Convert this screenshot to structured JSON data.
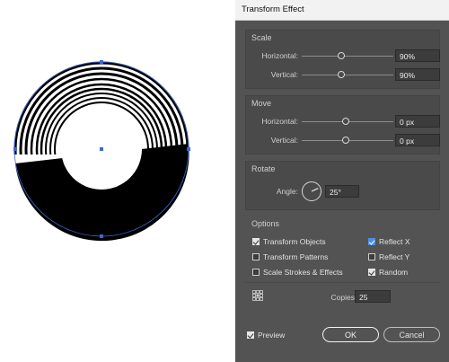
{
  "dialog": {
    "title": "Transform Effect",
    "scale": {
      "title": "Scale",
      "horizontal_label": "Horizontal:",
      "horizontal_value": "90%",
      "vertical_label": "Vertical:",
      "vertical_value": "90%"
    },
    "move": {
      "title": "Move",
      "horizontal_label": "Horizontal:",
      "horizontal_value": "0 px",
      "vertical_label": "Vertical:",
      "vertical_value": "0 px"
    },
    "rotate": {
      "title": "Rotate",
      "angle_label": "Angle:",
      "angle_value": "25°",
      "angle_degrees": 25
    },
    "options": {
      "title": "Options",
      "transform_objects": {
        "label": "Transform Objects",
        "checked": true
      },
      "transform_patterns": {
        "label": "Transform Patterns",
        "checked": false
      },
      "scale_strokes": {
        "label": "Scale Strokes & Effects",
        "checked": false
      },
      "reflect_x": {
        "label": "Reflect X",
        "checked": true
      },
      "reflect_y": {
        "label": "Reflect Y",
        "checked": false
      },
      "random": {
        "label": "Random",
        "checked": true
      },
      "copies_label": "Copies",
      "copies_value": "25"
    },
    "preview": {
      "label": "Preview",
      "checked": true
    },
    "ok_label": "OK",
    "cancel_label": "Cancel"
  },
  "colors": {
    "dialog_bg": "#535353",
    "section_bg": "#4a4a4a",
    "selection_blue": "#3d66d4",
    "checkbox_accent": "#4d8fe0"
  }
}
